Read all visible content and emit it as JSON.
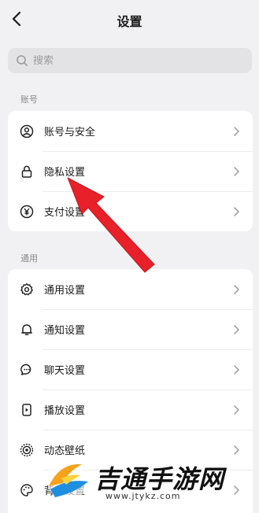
{
  "header": {
    "title": "设置"
  },
  "search": {
    "placeholder": "搜索"
  },
  "sections": [
    {
      "label": "账号",
      "items": [
        {
          "label": "账号与安全",
          "icon": "user-circle-icon"
        },
        {
          "label": "隐私设置",
          "icon": "lock-icon"
        },
        {
          "label": "支付设置",
          "icon": "yen-circle-icon"
        }
      ]
    },
    {
      "label": "通用",
      "items": [
        {
          "label": "通用设置",
          "icon": "gear-icon"
        },
        {
          "label": "通知设置",
          "icon": "bell-icon"
        },
        {
          "label": "聊天设置",
          "icon": "chat-bubble-icon"
        },
        {
          "label": "播放设置",
          "icon": "play-device-icon"
        },
        {
          "label": "动态壁纸",
          "icon": "wallpaper-icon"
        },
        {
          "label": "背景设置",
          "icon": "palette-icon"
        }
      ]
    }
  ],
  "annotation": {
    "color": "#e8202a",
    "icon": "red-arrow-pointer"
  },
  "watermark": {
    "text": "吉通手游网",
    "url": "www.jtykz.com",
    "logo": "watermark-logo"
  }
}
